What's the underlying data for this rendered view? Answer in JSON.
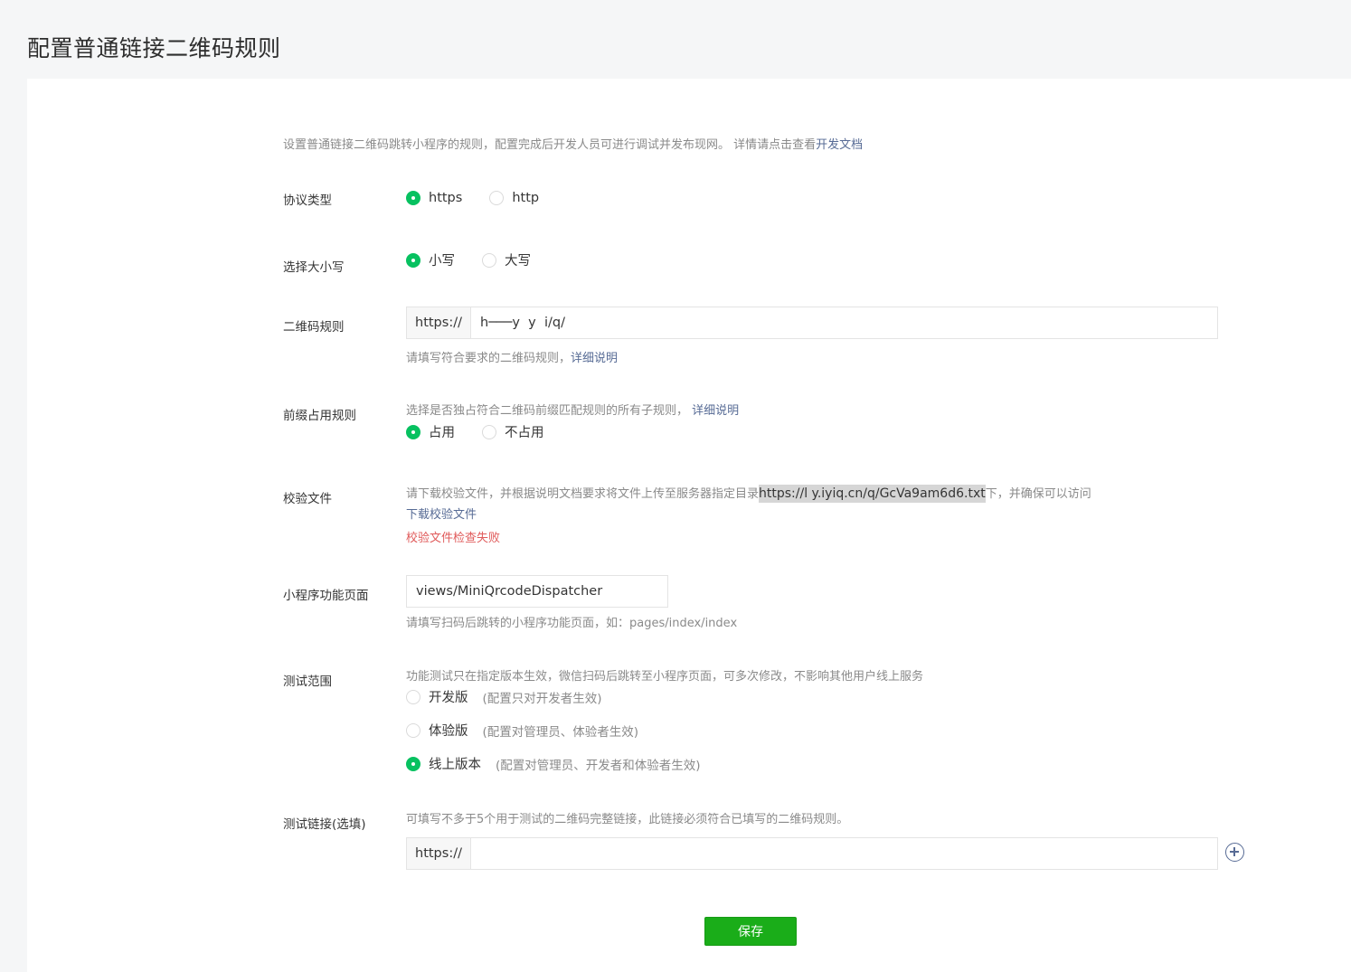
{
  "page": {
    "title": "配置普通链接二维码规则"
  },
  "intro": {
    "text": "设置普通链接二维码跳转小程序的规则，配置完成后开发人员可进行调试并发布现网。 详情请点击查看",
    "link": "开发文档"
  },
  "protocol": {
    "label": "协议类型",
    "options": [
      {
        "label": "https",
        "checked": true
      },
      {
        "label": "http",
        "checked": false
      }
    ]
  },
  "case": {
    "label": "选择大小写",
    "options": [
      {
        "label": "小写",
        "checked": true
      },
      {
        "label": "大写",
        "checked": false
      }
    ]
  },
  "rule": {
    "label": "二维码规则",
    "prefix": "https://",
    "value": "h───y  y  i/q/",
    "hint": "请填写符合要求的二维码规则，",
    "hint_link": "详细说明"
  },
  "prefix_rule": {
    "label": "前缀占用规则",
    "hint": "选择是否独占符合二维码前缀匹配规则的所有子规则，",
    "hint_link": "详细说明",
    "options": [
      {
        "label": "占用",
        "checked": true
      },
      {
        "label": "不占用",
        "checked": false
      }
    ]
  },
  "verify": {
    "label": "校验文件",
    "text_before": "请下载校验文件，并根据说明文档要求将文件上传至服务器指定目录",
    "url": "https://l     y.iyiq.cn/q/GcVa9am6d6.txt",
    "text_after": "下，并确保可以访问",
    "download": "下载校验文件",
    "error": "校验文件检查失败"
  },
  "mini_page": {
    "label": "小程序功能页面",
    "value": "views/MiniQrcodeDispatcher",
    "hint": "请填写扫码后跳转的小程序功能页面，如：pages/index/index"
  },
  "test_scope": {
    "label": "测试范围",
    "hint": "功能测试只在指定版本生效，微信扫码后跳转至小程序页面，可多次修改，不影响其他用户线上服务",
    "options": [
      {
        "label": "开发版",
        "sub": "(配置只对开发者生效)",
        "checked": false
      },
      {
        "label": "体验版",
        "sub": "(配置对管理员、体验者生效)",
        "checked": false
      },
      {
        "label": "线上版本",
        "sub": "(配置对管理员、开发者和体验者生效)",
        "checked": true
      }
    ]
  },
  "test_link": {
    "label": "测试链接(选填)",
    "hint": "可填写不多于5个用于测试的二维码完整链接，此链接必须符合已填写的二维码规则。",
    "prefix": "https://",
    "value": ""
  },
  "save": {
    "label": "保存"
  },
  "colors": {
    "accent": "#07c160",
    "button": "#1aad19",
    "link": "#576b95",
    "error": "#e05a5a"
  }
}
